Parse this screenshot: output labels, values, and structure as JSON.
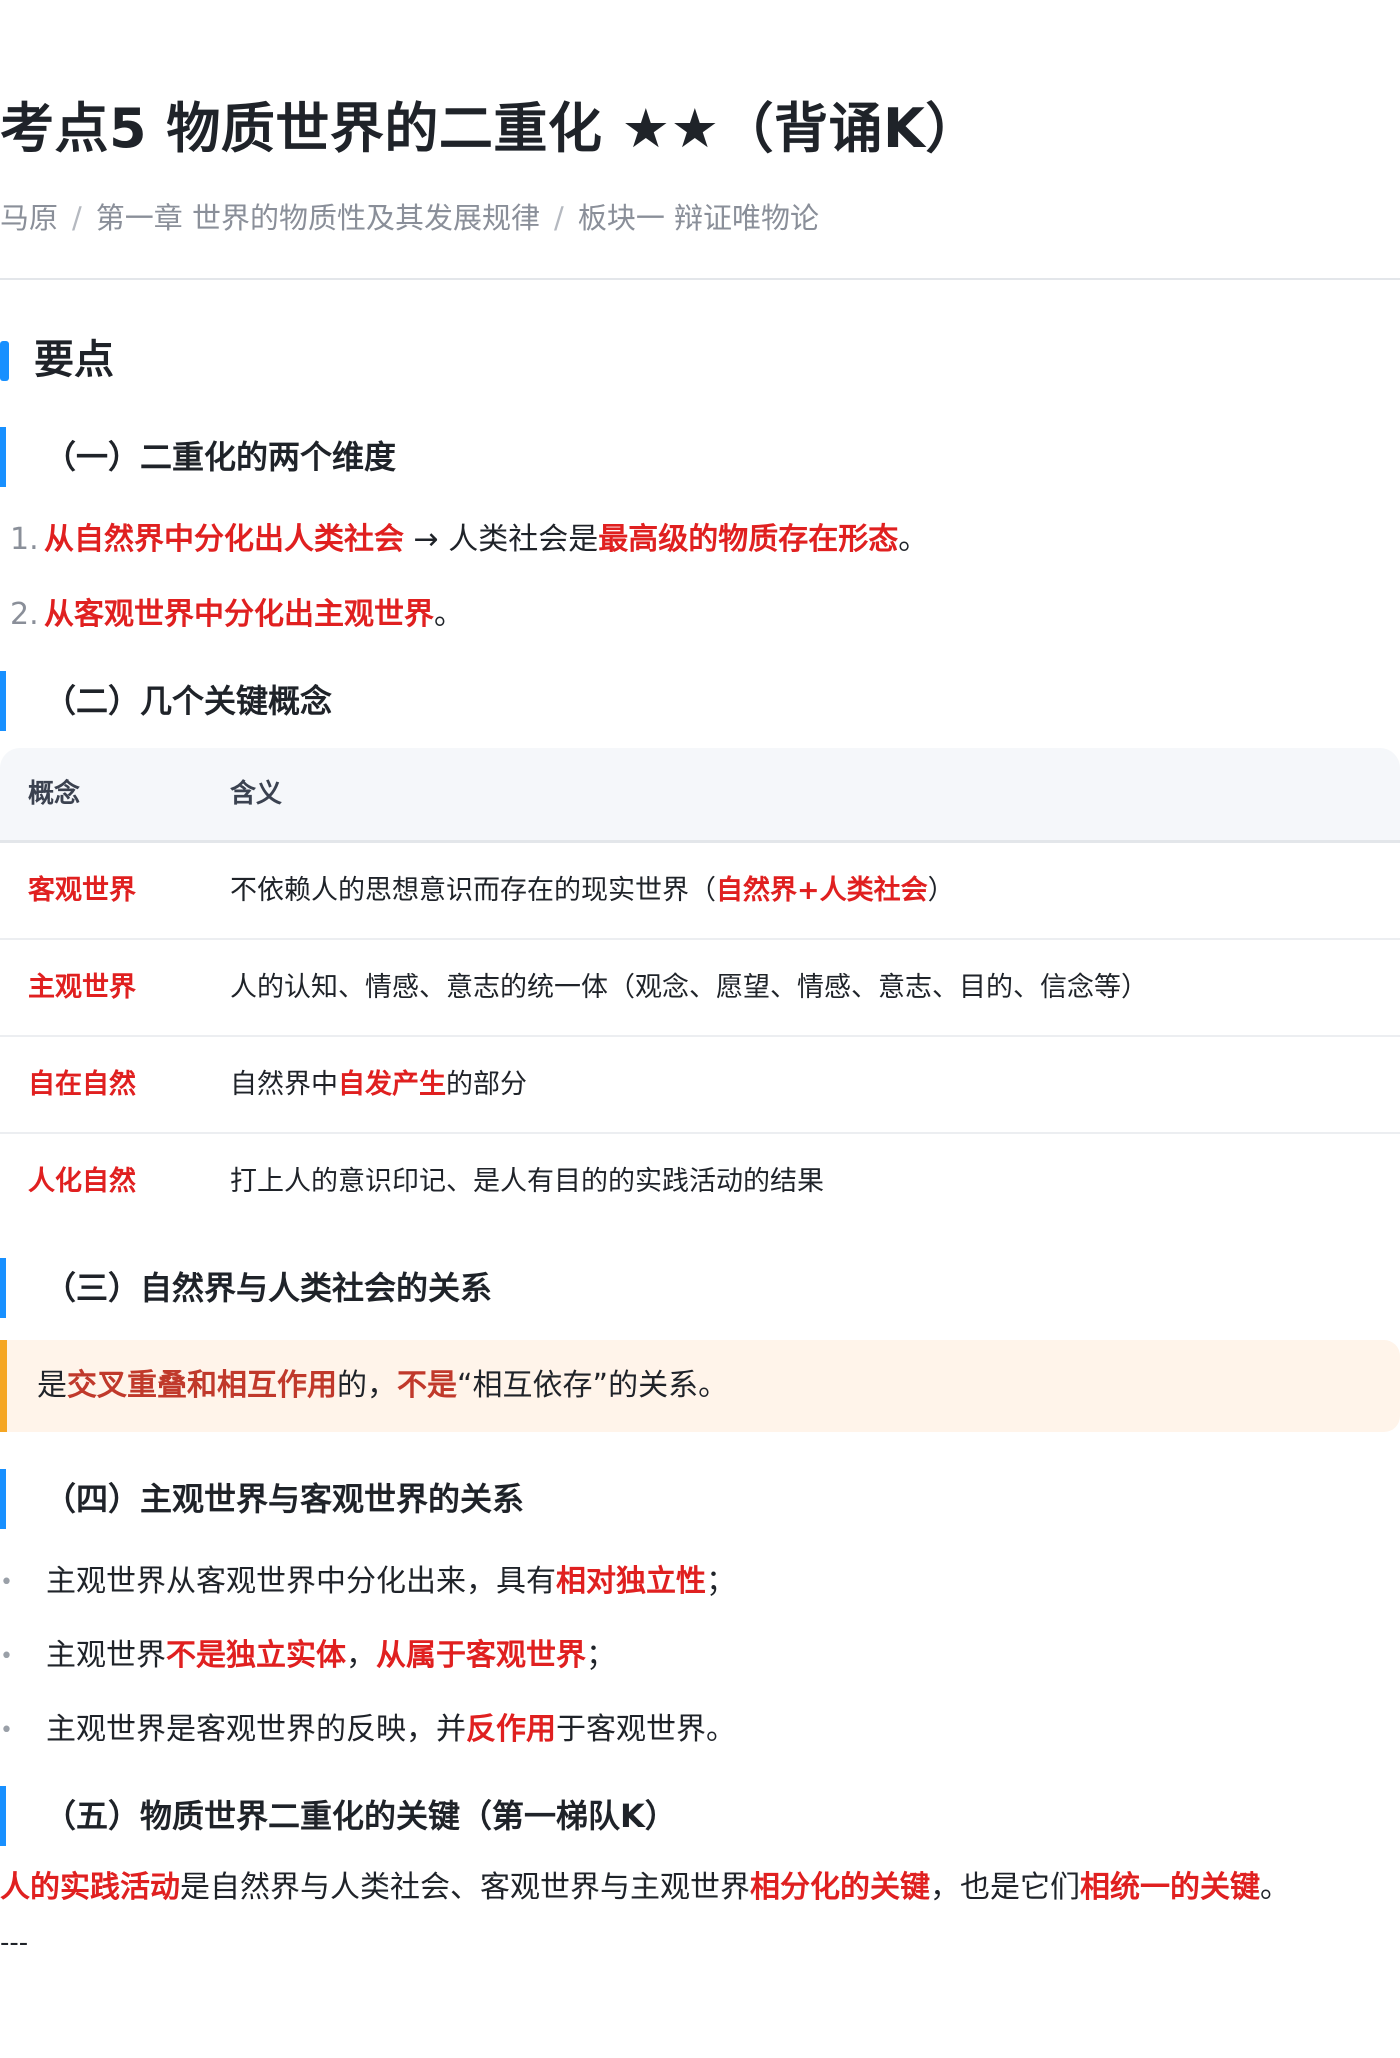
{
  "title": "考点5 物质世界的二重化 ★★（背诵K）",
  "breadcrumb": {
    "items": [
      "马原",
      "第一章 世界的物质性及其发展规律",
      "板块一 辩证唯物论"
    ],
    "separator": "/"
  },
  "section_title": "要点",
  "s1": {
    "heading": "（一）二重化的两个维度",
    "items": [
      {
        "num": "1.",
        "a_red": "从自然界中分化出人类社会",
        "b": " → 人类社会是",
        "c_red": "最高级的物质存在形态",
        "d": "。"
      },
      {
        "num": "2.",
        "a_red": "从客观世界中分化出主观世界",
        "b": "。"
      }
    ]
  },
  "s2": {
    "heading": "（二）几个关键概念",
    "columns": [
      "概念",
      "含义"
    ],
    "rows": [
      {
        "term": "客观世界",
        "pre": "不依赖人的思想意识而存在的现实世界（",
        "red": "自然界+人类社会",
        "post": "）"
      },
      {
        "term": "主观世界",
        "pre": "人的认知、情感、意志的统一体（观念、愿望、情感、意志、目的、信念等）",
        "red": "",
        "post": ""
      },
      {
        "term": "自在自然",
        "pre": "自然界中",
        "red": "自发产生",
        "post": "的部分"
      },
      {
        "term": "人化自然",
        "pre": "打上人的意识印记、是人有目的的实践活动的结果",
        "red": "",
        "post": ""
      }
    ]
  },
  "s3": {
    "heading": "（三）自然界与人类社会的关系",
    "callout": {
      "p1": "是",
      "p2_red": "交叉重叠和相互作用",
      "p3": "的，",
      "p4_red": "不是",
      "p5": "“相互依存”的关系。"
    }
  },
  "s4": {
    "heading": "（四）主观世界与客观世界的关系",
    "bullet": "•",
    "items": [
      {
        "a": "主观世界从客观世界中分化出来，具有",
        "b_red": "相对独立性",
        "c": "；",
        "d_red": "",
        "e": ""
      },
      {
        "a": "主观世界",
        "b_red": "不是独立实体",
        "c": "，",
        "d_red": "从属于客观世界",
        "e": "；"
      },
      {
        "a": "主观世界是客观世界的反映，并",
        "b_red": "反作用",
        "c": "于客观世界。",
        "d_red": "",
        "e": ""
      }
    ]
  },
  "s5": {
    "heading": "（五）物质世界二重化的关键（第一梯队K）",
    "para": {
      "a_red": "人的实践活动",
      "b": "是自然界与人类社会、客观世界与主观世界",
      "c_red": "相分化的关键",
      "d": "，也是它们",
      "e_red": "相统一的关键",
      "f": "。"
    }
  },
  "hr_text": "---"
}
